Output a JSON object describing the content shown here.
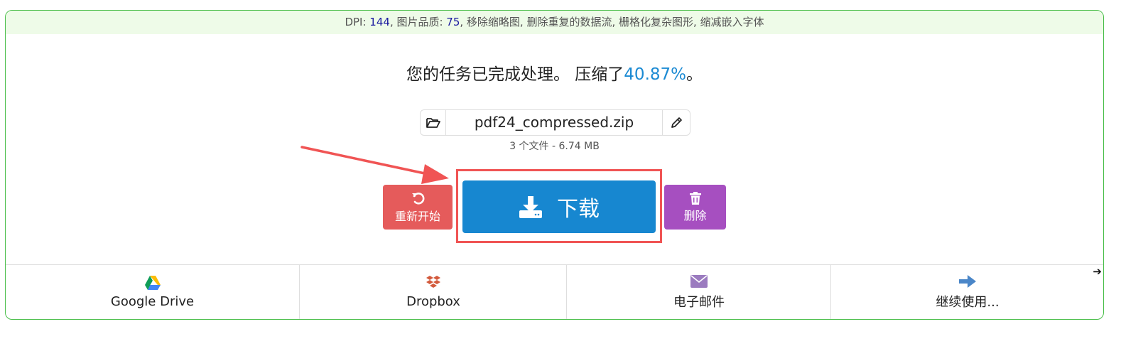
{
  "info_bar": {
    "dpi_label": "DPI: ",
    "dpi_value": "144",
    "quality_label": ", 图片品质: ",
    "quality_value": "75",
    "rest": ", 移除缩略图, 删除重复的数据流, 栅格化复杂图形, 缩减嵌入字体"
  },
  "result": {
    "message": "您的任务已完成处理。 压缩了",
    "percent": "40.87%",
    "suffix": "。"
  },
  "file": {
    "name": "pdf24_compressed.zip",
    "meta": "3 个文件 - 6.74 MB"
  },
  "buttons": {
    "restart_label": "重新开始",
    "download_label": "下载",
    "delete_label": "删除"
  },
  "services": [
    {
      "label": "Google Drive",
      "icon": "google-drive-icon"
    },
    {
      "label": "Dropbox",
      "icon": "dropbox-icon"
    },
    {
      "label": "电子邮件",
      "icon": "envelope-icon"
    },
    {
      "label": "继续使用...",
      "icon": "arrow-right-icon"
    }
  ],
  "colors": {
    "panel_border": "#4cbf4c",
    "info_bg": "#eefbe8",
    "accent_blue": "#1787d0",
    "restart_red": "#e55b5b",
    "delete_purple": "#a64fc0",
    "annotation_red": "#f05454"
  }
}
